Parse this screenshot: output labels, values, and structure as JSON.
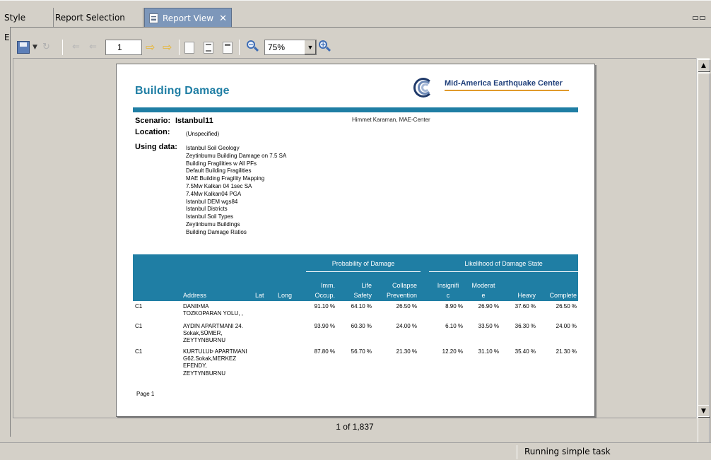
{
  "tabs": [
    {
      "label": "Style Editor",
      "active": false
    },
    {
      "label": "Report Selection View",
      "active": false
    },
    {
      "label": "Report View",
      "active": true
    }
  ],
  "toolbar": {
    "page_value": "1",
    "zoom_value": "75%"
  },
  "report": {
    "title": "Building Damage",
    "logo_text": "Mid-America Earthquake Center",
    "scenario_label": "Scenario:",
    "scenario_value": "Istanbul11",
    "author": "Himmet Karaman, MAE-Center",
    "location_label": "Location:",
    "location_value": "(Unspecified)",
    "using_label": "Using data:",
    "datasets": [
      "Istanbul Soil Geology",
      "Zeytinbumu Building Damage on 7.5 SA",
      "Building Fragilities w All PFs",
      "Default Building Fragilities",
      "MAE Building Fragility Mapping",
      "7.5Mw Kalkan 04 1sec SA",
      "7.4Mw Kalkan04 PGA",
      "Istanbul DEM wgs84",
      "Istanbul Districts",
      "Istanbul Soil Types",
      "Zeytinbumu Buildings",
      "Building Damage Ratios"
    ],
    "table": {
      "group_prob": "Probability of Damage",
      "group_like": "Likelihood of Damage State",
      "col_address": "Address",
      "col_lat": "Lat",
      "col_long": "Long",
      "col_imm_1": "Imm.",
      "col_imm_2": "Occup.",
      "col_life_1": "Life",
      "col_life_2": "Safety",
      "col_coll_1": "Collapse",
      "col_coll_2": "Prevention",
      "col_insig_1": "Insignifi",
      "col_insig_2": "c",
      "col_mod_1": "Moderat",
      "col_mod_2": "e",
      "col_heavy": "Heavy",
      "col_complete": "Complete",
      "rows": [
        {
          "id": "C1",
          "address": "DANIÞMA\nTOZKOPARAN YOLU, ,",
          "imm": "91.10 %",
          "life": "64.10 %",
          "coll": "26.50 %",
          "insig": "8.90 %",
          "mod": "26.90 %",
          "heavy": "37.60 %",
          "complete": "26.50 %"
        },
        {
          "id": "C1",
          "address": "AYDIN APARTMANI 24.\nSokak,SÜMER,\nZEYTYNBURNU",
          "imm": "93.90 %",
          "life": "60.30 %",
          "coll": "24.00 %",
          "insig": "6.10 %",
          "mod": "33.50 %",
          "heavy": "36.30 %",
          "complete": "24.00 %"
        },
        {
          "id": "C1",
          "address": "KURTULUÞ APARTMANI\nG62.Sokak,MERKEZ\nEFENDY,\nZEYTYNBURNU",
          "imm": "87.80 %",
          "life": "56.70 %",
          "coll": "21.30 %",
          "insig": "12.20 %",
          "mod": "31.10 %",
          "heavy": "35.40 %",
          "complete": "21.30 %"
        }
      ]
    },
    "page_label": "Page 1"
  },
  "pagination": "1 of 1,837",
  "status": "Running simple task",
  "colors": {
    "report_accent": "#1f7ea4",
    "active_tab": "#7d97ba"
  }
}
